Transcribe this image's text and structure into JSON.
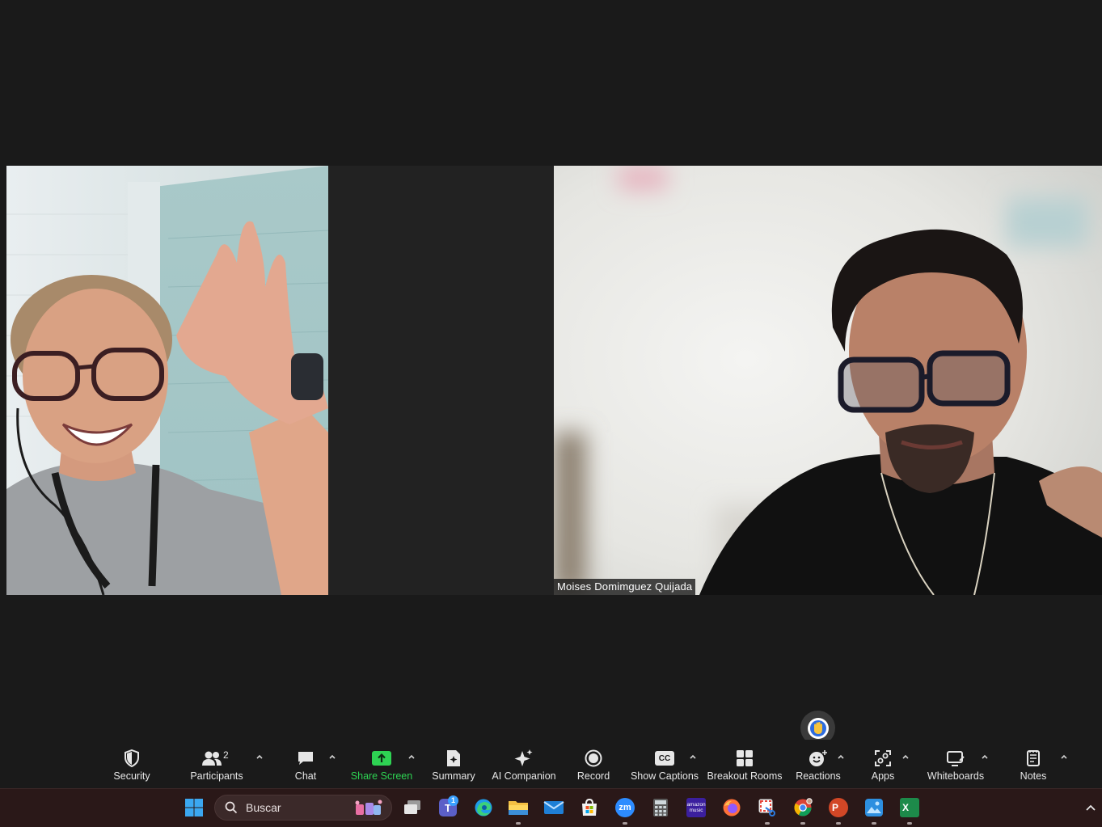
{
  "participants": {
    "right_name": "Moises Domimguez Quijada"
  },
  "toolbar": {
    "security": "Security",
    "participants": "Participants",
    "participants_count": "2",
    "chat": "Chat",
    "share_screen": "Share Screen",
    "summary": "Summary",
    "ai_companion": "AI Companion",
    "record": "Record",
    "show_captions": "Show Captions",
    "breakout_rooms": "Breakout Rooms",
    "reactions": "Reactions",
    "apps": "Apps",
    "whiteboards": "Whiteboards",
    "notes": "Notes",
    "captions_icon_text": "CC"
  },
  "taskbar": {
    "search_placeholder": "Buscar",
    "teams_badge": "1",
    "zoom_icon_text": "zm",
    "amazon_music_text": "amazon music",
    "powerpoint_letter": "P",
    "excel_letter": "X",
    "teams_letter": "T"
  },
  "colors": {
    "share_green": "#2ed353",
    "toolbar_bg": "#1a1a1a",
    "taskbar_bg": "#2a1818"
  },
  "icons": {
    "raise_hand": "raised-hand-icon",
    "windows": "windows-start-icon",
    "show_hidden": "chevron-up-icon"
  }
}
